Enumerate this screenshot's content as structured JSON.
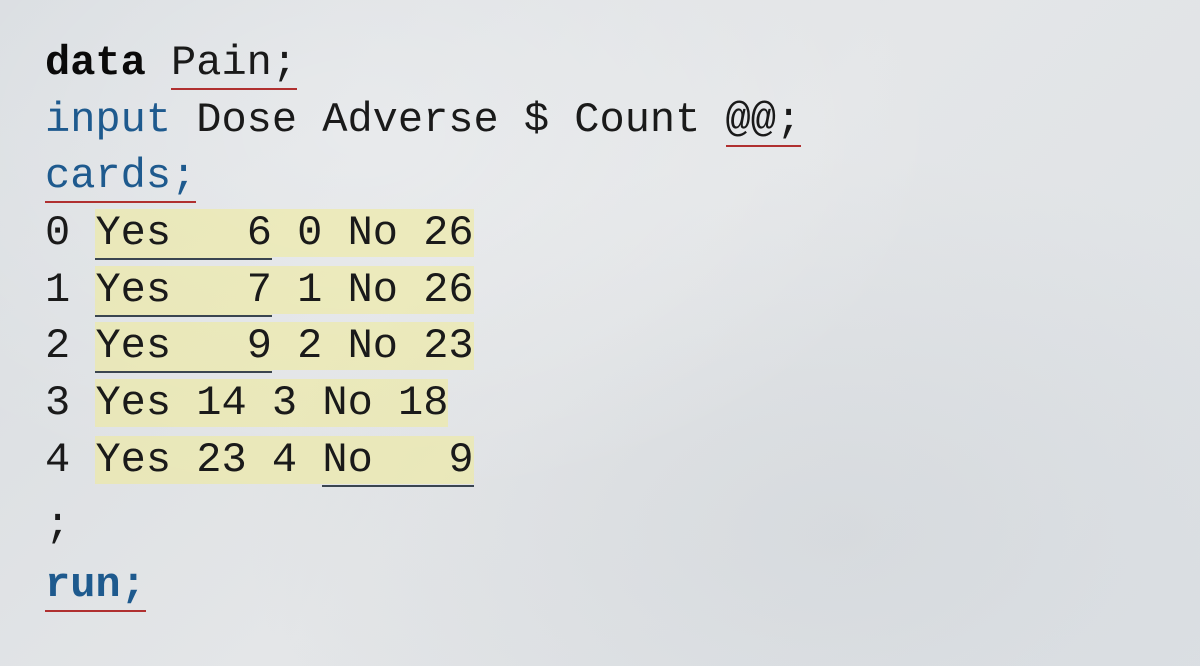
{
  "code": {
    "line1": {
      "keyword": "data",
      "dataset": "Pain",
      "terminator": ";"
    },
    "line2": {
      "keyword": "input",
      "vars": " Dose Adverse $ Count ",
      "trailing": "@@",
      "terminator": ";"
    },
    "line3": {
      "keyword": "cards",
      "terminator": ";"
    },
    "data_rows": [
      {
        "dose1": "0",
        "yes": "Yes",
        "count1": " 6",
        "dose2": "0",
        "no": "No",
        "count2": "26"
      },
      {
        "dose1": "1",
        "yes": "Yes",
        "count1": " 7",
        "dose2": "1",
        "no": "No",
        "count2": "26"
      },
      {
        "dose1": "2",
        "yes": "Yes",
        "count1": " 9",
        "dose2": "2",
        "no": "No",
        "count2": "23"
      },
      {
        "dose1": "3",
        "yes": "Yes",
        "count1": "14",
        "dose2": "3",
        "no": "No",
        "count2": "18"
      },
      {
        "dose1": "4",
        "yes": "Yes",
        "count1": "23",
        "dose2": "4",
        "no": "No",
        "count2": " 9"
      }
    ],
    "terminator_line": ";",
    "run": {
      "keyword": "run",
      "terminator": ";"
    }
  }
}
